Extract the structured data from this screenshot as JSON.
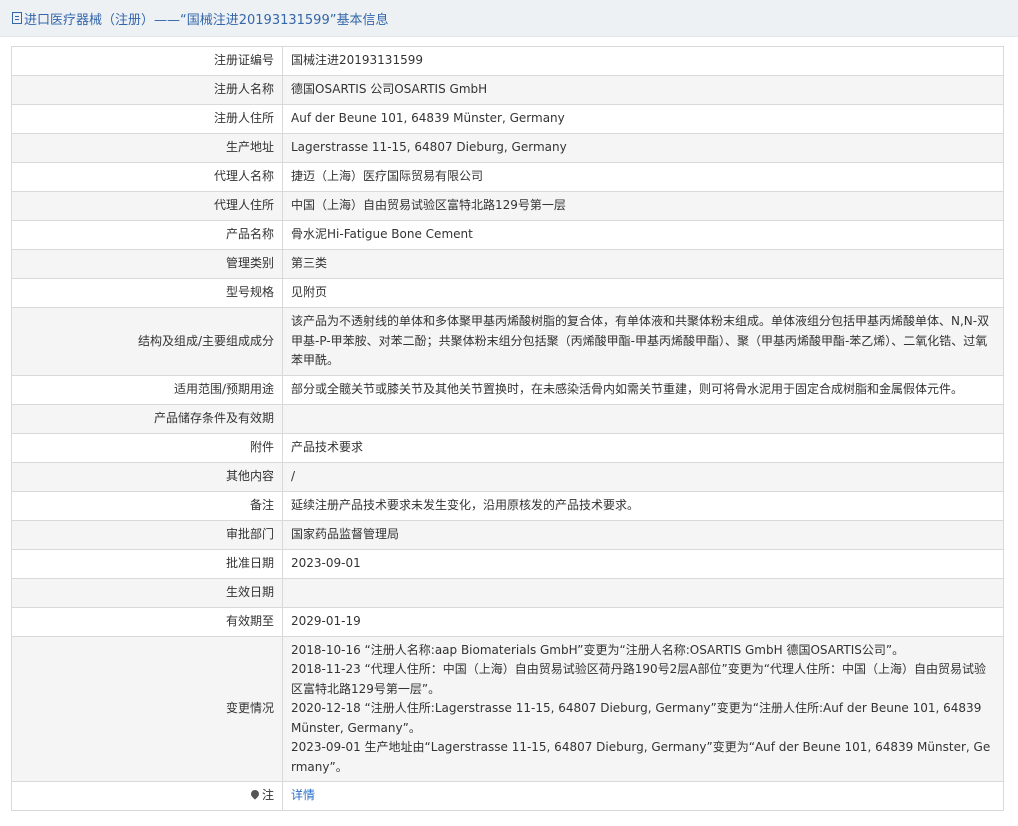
{
  "header": {
    "title": "进口医疗器械（注册）——“国械注进20193131599”基本信息"
  },
  "rows": [
    {
      "label": "注册证编号",
      "value": "国械注进20193131599"
    },
    {
      "label": "注册人名称",
      "value": "德国OSARTIS 公司OSARTIS GmbH"
    },
    {
      "label": "注册人住所",
      "value": "Auf der Beune 101, 64839 Münster, Germany"
    },
    {
      "label": "生产地址",
      "value": "Lagerstrasse 11-15, 64807 Dieburg, Germany"
    },
    {
      "label": "代理人名称",
      "value": "捷迈（上海）医疗国际贸易有限公司"
    },
    {
      "label": "代理人住所",
      "value": "中国（上海）自由贸易试验区富特北路129号第一层"
    },
    {
      "label": "产品名称",
      "value": "骨水泥Hi-Fatigue Bone Cement"
    },
    {
      "label": "管理类别",
      "value": "第三类"
    },
    {
      "label": "型号规格",
      "value": "见附页"
    },
    {
      "label": "结构及组成/主要组成成分",
      "value": "该产品为不透射线的单体和多体聚甲基丙烯酸树脂的复合体，有单体液和共聚体粉末组成。单体液组分包括甲基丙烯酸单体、N,N-双甲基-P-甲苯胺、对苯二酚；共聚体粉末组分包括聚（丙烯酸甲酯-甲基丙烯酸甲酯）、聚（甲基丙烯酸甲酯-苯乙烯）、二氧化锆、过氧苯甲酰。"
    },
    {
      "label": "适用范围/预期用途",
      "value": "部分或全髋关节或膝关节及其他关节置换时，在未感染活骨内如需关节重建，则可将骨水泥用于固定合成树脂和金属假体元件。"
    },
    {
      "label": "产品储存条件及有效期",
      "value": ""
    },
    {
      "label": "附件",
      "value": "产品技术要求"
    },
    {
      "label": "其他内容",
      "value": "/"
    },
    {
      "label": "备注",
      "value": "延续注册产品技术要求未发生变化，沿用原核发的产品技术要求。"
    },
    {
      "label": "审批部门",
      "value": "国家药品监督管理局"
    },
    {
      "label": "批准日期",
      "value": "2023-09-01"
    },
    {
      "label": "生效日期",
      "value": ""
    },
    {
      "label": "有效期至",
      "value": "2029-01-19"
    }
  ],
  "changes": {
    "label": "变更情况",
    "lines": [
      "2018-10-16 “注册人名称:aap Biomaterials GmbH”变更为“注册人名称:OSARTIS GmbH 德国OSARTIS公司”。",
      "2018-11-23 “代理人住所：中国（上海）自由贸易试验区荷丹路190号2层A部位”变更为“代理人住所：中国（上海）自由贸易试验区富特北路129号第一层”。",
      "2020-12-18 “注册人住所:Lagerstrasse 11-15, 64807 Dieburg, Germany”变更为“注册人住所:Auf der Beune 101, 64839 Münster, Germany”。",
      "2023-09-01 生产地址由“Lagerstrasse 11-15, 64807 Dieburg, Germany”变更为“Auf der Beune 101, 64839 Münster, Germany”。"
    ]
  },
  "note": {
    "label": "注",
    "icon": "location-pin-icon",
    "link_text": "详情"
  },
  "colors": {
    "title_text": "#3366aa",
    "link": "#2a6fc9",
    "alt_row_bg": "#f5f5f5",
    "border": "#d9d9d9"
  }
}
